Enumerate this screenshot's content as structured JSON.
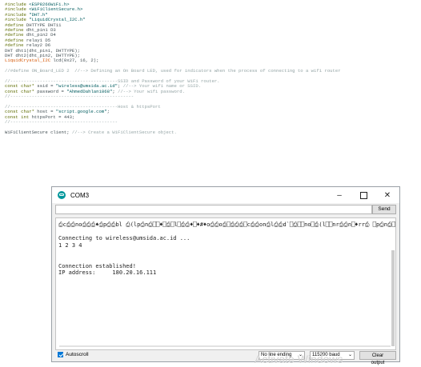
{
  "code_lines": [
    {
      "parts": [
        {
          "c": "k",
          "t": "#include "
        },
        {
          "c": "s",
          "t": "<ESP8266WiFi.h>"
        }
      ]
    },
    {
      "parts": [
        {
          "c": "k",
          "t": "#include "
        },
        {
          "c": "s",
          "t": "<WiFiClientSecure.h>"
        }
      ]
    },
    {
      "parts": [
        {
          "c": "k",
          "t": "#include "
        },
        {
          "c": "s",
          "t": "\"DHT.h\""
        }
      ]
    },
    {
      "parts": [
        {
          "c": "k",
          "t": "#include "
        },
        {
          "c": "s",
          "t": "\"LiquidCrystal_I2C.h\""
        }
      ]
    },
    {
      "parts": [
        {
          "c": "k",
          "t": "#define "
        },
        {
          "c": "n",
          "t": "DHTTYPE DHT11"
        }
      ]
    },
    {
      "parts": [
        {
          "c": "k",
          "t": "#define "
        },
        {
          "c": "n",
          "t": "dht_pin1 D3"
        }
      ]
    },
    {
      "parts": [
        {
          "c": "k",
          "t": "#define "
        },
        {
          "c": "n",
          "t": "dht_pin2 D4"
        }
      ]
    },
    {
      "parts": [
        {
          "c": "k",
          "t": "#define "
        },
        {
          "c": "n",
          "t": "relay1 D5"
        }
      ]
    },
    {
      "parts": [
        {
          "c": "k",
          "t": "#define "
        },
        {
          "c": "n",
          "t": "relay2 D6"
        }
      ]
    },
    {
      "parts": [
        {
          "c": "n",
          "t": "DHT dht1(dht_pin1, DHTTYPE);"
        }
      ]
    },
    {
      "parts": [
        {
          "c": "n",
          "t": "DHT dht2(dht_pin2, DHTTYPE);"
        }
      ]
    },
    {
      "parts": [
        {
          "c": "t",
          "t": "LiquidCrystal_I2C"
        },
        {
          "c": "n",
          "t": " lcd(0x27, 16, 2);"
        }
      ]
    },
    {
      "gap": true
    },
    {
      "parts": [
        {
          "c": "c",
          "t": "//#define ON_Board_LED 2  //--> Defining an On Board LED, used for indicators when the process of connecting to a wifi router"
        }
      ]
    },
    {
      "gap": true
    },
    {
      "parts": [
        {
          "c": "c",
          "t": "//----------------------------------------SSID and Password of your WiFi router."
        }
      ]
    },
    {
      "parts": [
        {
          "c": "k",
          "t": "const char* "
        },
        {
          "c": "n",
          "t": "ssid = "
        },
        {
          "c": "s",
          "t": "\"wireless@umsida.ac.id\""
        },
        {
          "c": "n",
          "t": "; "
        },
        {
          "c": "c",
          "t": "//--> Your wifi name or SSID."
        }
      ]
    },
    {
      "parts": [
        {
          "c": "k",
          "t": "const char* "
        },
        {
          "c": "n",
          "t": "password = "
        },
        {
          "c": "s",
          "t": "\"AhmedDahlan1868\""
        },
        {
          "c": "n",
          "t": "; "
        },
        {
          "c": "c",
          "t": "//--> Your wifi password."
        }
      ]
    },
    {
      "parts": [
        {
          "c": "c",
          "t": "//----------------------------------------------"
        }
      ]
    },
    {
      "gap": true
    },
    {
      "parts": [
        {
          "c": "c",
          "t": "//----------------------------------------Host & httpsPort"
        }
      ]
    },
    {
      "parts": [
        {
          "c": "k",
          "t": "const char* "
        },
        {
          "c": "n",
          "t": "host = "
        },
        {
          "c": "s",
          "t": "\"script.google.com\""
        },
        {
          "c": "n",
          "t": ";"
        }
      ]
    },
    {
      "parts": [
        {
          "c": "k",
          "t": "const int "
        },
        {
          "c": "n",
          "t": "httpsPort = 443;"
        }
      ]
    },
    {
      "parts": [
        {
          "c": "c",
          "t": "//----------------------------------------"
        }
      ]
    },
    {
      "gap": true
    },
    {
      "parts": [
        {
          "c": "n",
          "t": "WiFiClientSecure client; "
        },
        {
          "c": "c",
          "t": "//--> Create a WiFiClientSecure object."
        }
      ]
    }
  ],
  "monitor": {
    "title": "COM3",
    "send_label": "Send",
    "input_value": "",
    "output_lines": [
      "⎙c⎙⎙no⎙⎙⎙♦⎙p⎙⎙bl ⎙(lp⎙n⎙⎕⎕♦⎕⎙⎕l⎕⎙⎙♦⎕♦#♦o⎙⎙o⎙⎕⎙⎙⎙⎕c⎙⎙on⎙l⎙⎙d`⎕⎙⎕⎕no⎕⎙(l⎕⎕nr⎙⎙n⎕♦rr⎙ ⎕p⎙n⎙⎕⎕♦",
      "",
      "Connecting to wireless@umsida.ac.id ...",
      "1 2 3 4",
      "",
      "",
      "Connection established!",
      "IP address:     180.20.16.111"
    ],
    "autoscroll_label": "Autoscroll",
    "line_ending": "No line ending",
    "baud": "115200 baud",
    "clear_label": "Clear output"
  },
  "watermark": "Activate Windows"
}
